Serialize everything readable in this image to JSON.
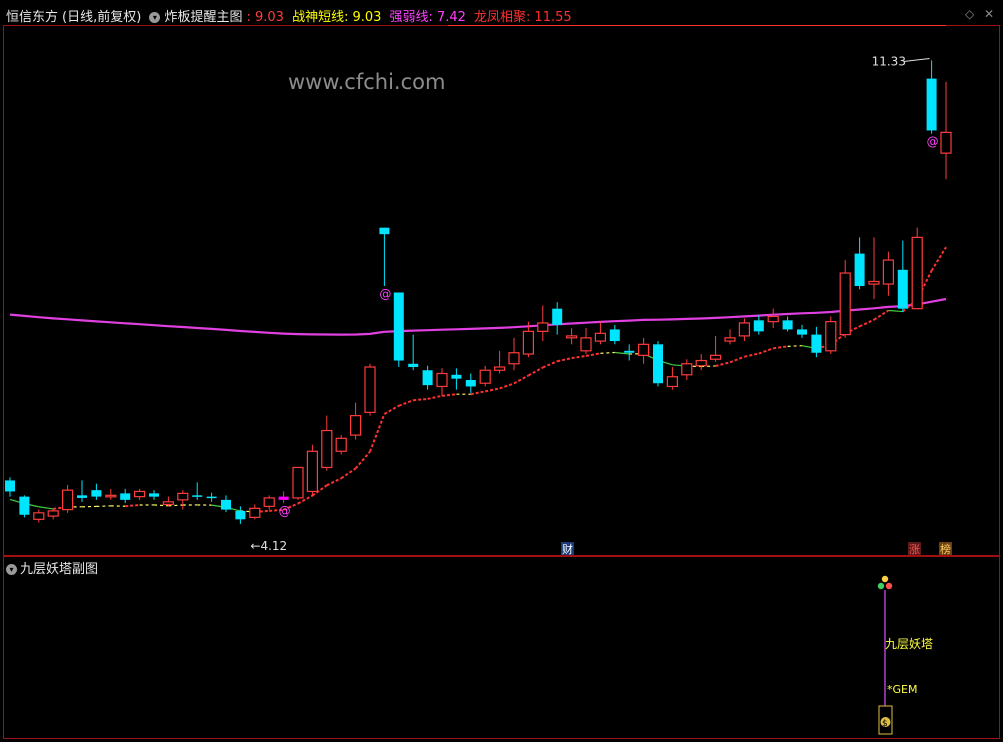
{
  "header": {
    "stock": "恒信东方",
    "period": "(日线,前复权)",
    "indicator": "炸板提醒主图",
    "v0_value": ": 9.03",
    "v1_label": "战神短线:",
    "v1_value": "9.03",
    "v2_label": "强弱线:",
    "v2_value": "7.42",
    "v3_label": "龙凤相聚:",
    "v3_value": "11.55"
  },
  "watermark": "www.cfchi.com",
  "annotations": {
    "high": "11.33",
    "low": "4.12",
    "at": "@",
    "cai": "财",
    "zhang": "涨",
    "bang": "榜"
  },
  "sub_panel": {
    "title": "九层妖塔副图",
    "tower_label": "九层妖塔",
    "gem_label": "*GEM",
    "bag_label": "$"
  },
  "controls": {
    "collapse": "◇",
    "close": "✕"
  },
  "colors": {
    "up": "#ff3c3c",
    "down": "#00e5ff",
    "magenta_line": "#e040e0",
    "header_yellow": "#ffff00",
    "strength": "#ff40ff",
    "dragon": "#ff3030",
    "panel_border": "#a01010"
  },
  "chart_data": {
    "type": "candlestick",
    "price_range": [
      3.9,
      11.8
    ],
    "candles": [
      {
        "o": 4.85,
        "c": 4.68,
        "h": 4.9,
        "l": 4.6
      },
      {
        "o": 4.6,
        "c": 4.32,
        "h": 4.62,
        "l": 4.28
      },
      {
        "o": 4.25,
        "c": 4.35,
        "h": 4.4,
        "l": 4.2
      },
      {
        "o": 4.3,
        "c": 4.38,
        "h": 4.42,
        "l": 4.25
      },
      {
        "o": 4.4,
        "c": 4.7,
        "h": 4.78,
        "l": 4.35
      },
      {
        "o": 4.62,
        "c": 4.58,
        "h": 4.85,
        "l": 4.52
      },
      {
        "o": 4.7,
        "c": 4.6,
        "h": 4.8,
        "l": 4.55
      },
      {
        "o": 4.6,
        "c": 4.62,
        "h": 4.72,
        "l": 4.55
      },
      {
        "o": 4.65,
        "c": 4.55,
        "h": 4.72,
        "l": 4.5
      },
      {
        "o": 4.6,
        "c": 4.68,
        "h": 4.72,
        "l": 4.55
      },
      {
        "o": 4.65,
        "c": 4.6,
        "h": 4.7,
        "l": 4.55
      },
      {
        "o": 4.48,
        "c": 4.52,
        "h": 4.6,
        "l": 4.45
      },
      {
        "o": 4.55,
        "c": 4.65,
        "h": 4.7,
        "l": 4.4
      },
      {
        "o": 4.62,
        "c": 4.6,
        "h": 4.82,
        "l": 4.55
      },
      {
        "o": 4.6,
        "c": 4.58,
        "h": 4.66,
        "l": 4.52
      },
      {
        "o": 4.55,
        "c": 4.4,
        "h": 4.62,
        "l": 4.36
      },
      {
        "o": 4.38,
        "c": 4.25,
        "h": 4.45,
        "l": 4.18
      },
      {
        "o": 4.28,
        "c": 4.42,
        "h": 4.48,
        "l": 4.25
      },
      {
        "o": 4.45,
        "c": 4.58,
        "h": 4.62,
        "l": 4.4
      },
      {
        "o": 4.55,
        "c": 4.6,
        "h": 4.68,
        "l": 4.5
      },
      {
        "o": 4.58,
        "c": 5.05,
        "h": 5.05,
        "l": 4.55
      },
      {
        "o": 4.68,
        "c": 5.3,
        "h": 5.4,
        "l": 4.6
      },
      {
        "o": 5.05,
        "c": 5.62,
        "h": 5.85,
        "l": 5.0
      },
      {
        "o": 5.3,
        "c": 5.5,
        "h": 5.55,
        "l": 5.25
      },
      {
        "o": 5.55,
        "c": 5.85,
        "h": 6.05,
        "l": 5.48
      },
      {
        "o": 5.9,
        "c": 6.6,
        "h": 6.65,
        "l": 5.85
      },
      {
        "o": 8.75,
        "c": 8.65,
        "h": 8.75,
        "l": 7.85
      },
      {
        "o": 7.75,
        "c": 6.7,
        "h": 7.75,
        "l": 6.6
      },
      {
        "o": 6.65,
        "c": 6.6,
        "h": 7.1,
        "l": 6.55
      },
      {
        "o": 6.55,
        "c": 6.32,
        "h": 6.62,
        "l": 6.25
      },
      {
        "o": 6.3,
        "c": 6.5,
        "h": 6.58,
        "l": 6.15
      },
      {
        "o": 6.48,
        "c": 6.42,
        "h": 6.58,
        "l": 6.25
      },
      {
        "o": 6.4,
        "c": 6.3,
        "h": 6.5,
        "l": 6.2
      },
      {
        "o": 6.35,
        "c": 6.55,
        "h": 6.62,
        "l": 6.3
      },
      {
        "o": 6.55,
        "c": 6.6,
        "h": 6.85,
        "l": 6.5
      },
      {
        "o": 6.65,
        "c": 6.82,
        "h": 7.05,
        "l": 6.55
      },
      {
        "o": 6.8,
        "c": 7.15,
        "h": 7.3,
        "l": 6.75
      },
      {
        "o": 7.15,
        "c": 7.28,
        "h": 7.55,
        "l": 7.0
      },
      {
        "o": 7.5,
        "c": 7.25,
        "h": 7.6,
        "l": 7.1
      },
      {
        "o": 7.05,
        "c": 7.08,
        "h": 7.2,
        "l": 6.95
      },
      {
        "o": 6.85,
        "c": 7.05,
        "h": 7.2,
        "l": 6.8
      },
      {
        "o": 7.0,
        "c": 7.12,
        "h": 7.3,
        "l": 6.95
      },
      {
        "o": 7.18,
        "c": 7.0,
        "h": 7.25,
        "l": 6.95
      },
      {
        "o": 6.85,
        "c": 6.82,
        "h": 6.95,
        "l": 6.7
      },
      {
        "o": 6.78,
        "c": 6.95,
        "h": 7.05,
        "l": 6.65
      },
      {
        "o": 6.95,
        "c": 6.35,
        "h": 7.0,
        "l": 6.3
      },
      {
        "o": 6.3,
        "c": 6.45,
        "h": 6.6,
        "l": 6.25
      },
      {
        "o": 6.48,
        "c": 6.65,
        "h": 6.72,
        "l": 6.4
      },
      {
        "o": 6.62,
        "c": 6.7,
        "h": 6.8,
        "l": 6.55
      },
      {
        "o": 6.72,
        "c": 6.78,
        "h": 7.08,
        "l": 6.68
      },
      {
        "o": 7.0,
        "c": 7.05,
        "h": 7.18,
        "l": 6.95
      },
      {
        "o": 7.08,
        "c": 7.28,
        "h": 7.35,
        "l": 7.0
      },
      {
        "o": 7.32,
        "c": 7.15,
        "h": 7.4,
        "l": 7.1
      },
      {
        "o": 7.3,
        "c": 7.38,
        "h": 7.5,
        "l": 7.2
      },
      {
        "o": 7.32,
        "c": 7.18,
        "h": 7.38,
        "l": 7.15
      },
      {
        "o": 7.18,
        "c": 7.1,
        "h": 7.25,
        "l": 7.05
      },
      {
        "o": 7.1,
        "c": 6.82,
        "h": 7.22,
        "l": 6.75
      },
      {
        "o": 6.85,
        "c": 7.3,
        "h": 7.38,
        "l": 6.8
      },
      {
        "o": 7.1,
        "c": 8.05,
        "h": 8.25,
        "l": 7.05
      },
      {
        "o": 8.35,
        "c": 7.85,
        "h": 8.6,
        "l": 7.8
      },
      {
        "o": 7.88,
        "c": 7.92,
        "h": 8.6,
        "l": 7.65
      },
      {
        "o": 7.88,
        "c": 8.25,
        "h": 8.38,
        "l": 7.7
      },
      {
        "o": 8.1,
        "c": 7.5,
        "h": 8.55,
        "l": 7.45
      },
      {
        "o": 7.5,
        "c": 8.6,
        "h": 8.75,
        "l": 7.5
      },
      {
        "o": 11.05,
        "c": 10.25,
        "h": 11.33,
        "l": 10.2
      },
      {
        "o": 9.9,
        "c": 10.22,
        "h": 11.0,
        "l": 9.5
      }
    ]
  }
}
